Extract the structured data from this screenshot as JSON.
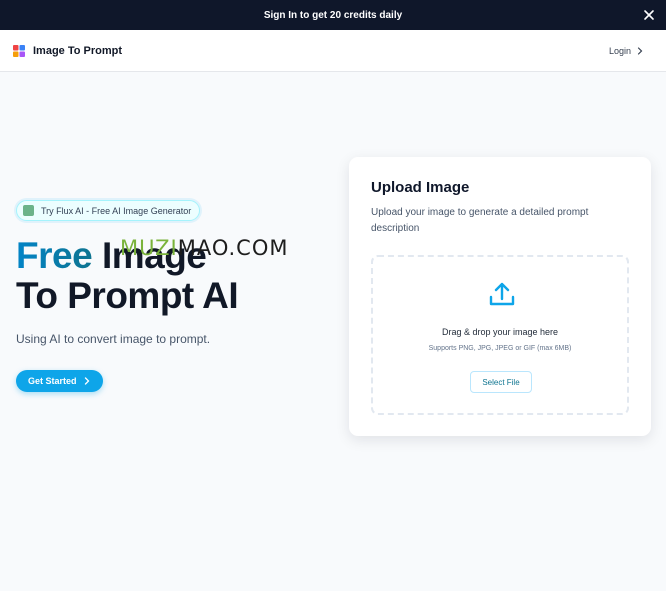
{
  "banner": {
    "text": "Sign In to get 20 credits daily"
  },
  "navbar": {
    "brand": "Image To Prompt",
    "login": "Login"
  },
  "hero": {
    "badge": "Try Flux AI - Free AI Image Generator",
    "title_accent": "Free",
    "title_rest_line1": "Image",
    "title_line2": "To Prompt AI",
    "subtitle": "Using AI to convert image to prompt.",
    "cta": "Get Started"
  },
  "watermark": {
    "part1": "MUZI",
    "part2": "MAO.COM"
  },
  "upload": {
    "title": "Upload Image",
    "description": "Upload your image to generate a detailed prompt description",
    "drop_text": "Drag & drop your image here",
    "hint": "Supports PNG, JPG, JPEG or GIF (max 6MB)",
    "select_button": "Select File"
  },
  "colors": {
    "accent": "#0ea5e9",
    "banner_bg": "#0f172a",
    "title_gradient_start": "#0284c7"
  },
  "icons": {
    "close": "close-icon",
    "logo": "logo-icon",
    "chevron": "chevron-right-icon",
    "upload": "upload-icon"
  }
}
